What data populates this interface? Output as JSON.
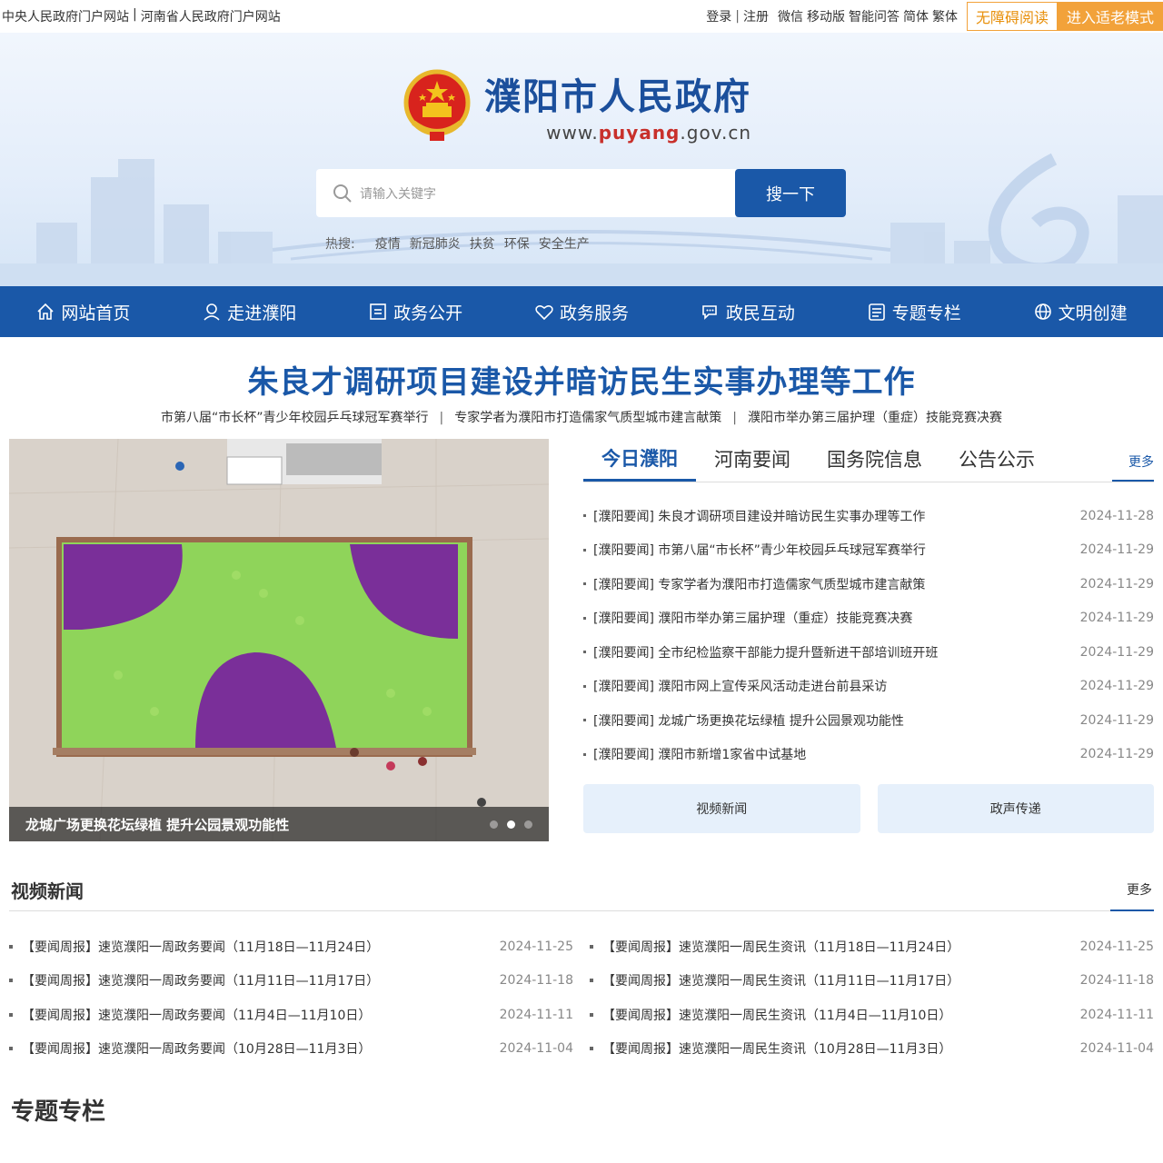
{
  "topbar": {
    "left_links": [
      "中央人民政府门户网站",
      "河南省人民政府门户网站"
    ],
    "login": "登录",
    "register": "注册",
    "right_links": [
      "微信",
      "移动版",
      "智能问答",
      "简体",
      "繁体"
    ],
    "accessible": "无障碍阅读",
    "elder": "进入适老模式"
  },
  "logo": {
    "title": "濮阳市人民政府",
    "url_pre": "www.",
    "url_hl": "puyang",
    "url_post": ".gov.cn"
  },
  "search": {
    "placeholder": "请输入关键字",
    "button": "搜一下",
    "hot_label": "热搜:",
    "hot_keywords": [
      "疫情",
      "新冠肺炎",
      "扶贫",
      "环保",
      "安全生产"
    ]
  },
  "nav": [
    {
      "label": "网站首页",
      "icon": "home-icon"
    },
    {
      "label": "走进濮阳",
      "icon": "person-icon"
    },
    {
      "label": "政务公开",
      "icon": "document-icon"
    },
    {
      "label": "政务服务",
      "icon": "heart-icon"
    },
    {
      "label": "政民互动",
      "icon": "chat-icon"
    },
    {
      "label": "专题专栏",
      "icon": "list-icon"
    },
    {
      "label": "文明创建",
      "icon": "globe-icon"
    }
  ],
  "headline": "朱良才调研项目建设并暗访民生实事办理等工作",
  "subheads": [
    "市第八届“市长杯”青少年校园乒乓球冠军赛举行",
    "专家学者为濮阳市打造儒家气质型城市建言献策",
    "濮阳市举办第三届护理（重症）技能竞赛决赛"
  ],
  "photo": {
    "caption": "龙城广场更换花坛绿植 提升公园景观功能性",
    "slides": 3,
    "active_slide": 2
  },
  "tabs": [
    "今日濮阳",
    "河南要闻",
    "国务院信息",
    "公告公示"
  ],
  "tabs_more": "更多",
  "news": [
    {
      "title": "[濮阳要闻] 朱良才调研项目建设并暗访民生实事办理等工作",
      "date": "2024-11-28"
    },
    {
      "title": "[濮阳要闻] 市第八届“市长杯”青少年校园乒乓球冠军赛举行",
      "date": "2024-11-29"
    },
    {
      "title": "[濮阳要闻] 专家学者为濮阳市打造儒家气质型城市建言献策",
      "date": "2024-11-29"
    },
    {
      "title": "[濮阳要闻] 濮阳市举办第三届护理（重症）技能竞赛决赛",
      "date": "2024-11-29"
    },
    {
      "title": "[濮阳要闻] 全市纪检监察干部能力提升暨新进干部培训班开班",
      "date": "2024-11-29"
    },
    {
      "title": "[濮阳要闻] 濮阳市网上宣传采风活动走进台前县采访",
      "date": "2024-11-29"
    },
    {
      "title": "[濮阳要闻] 龙城广场更换花坛绿植 提升公园景观功能性",
      "date": "2024-11-29"
    },
    {
      "title": "[濮阳要闻] 濮阳市新增1家省中试基地",
      "date": "2024-11-29"
    }
  ],
  "sub_buttons": [
    "视频新闻",
    "政声传递"
  ],
  "video": {
    "title": "视频新闻",
    "more": "更多",
    "left": [
      {
        "title": "【要闻周报】速览濮阳一周政务要闻（11月18日—11月24日）",
        "date": "2024-11-25"
      },
      {
        "title": "【要闻周报】速览濮阳一周政务要闻（11月11日—11月17日）",
        "date": "2024-11-18"
      },
      {
        "title": "【要闻周报】速览濮阳一周政务要闻（11月4日—11月10日）",
        "date": "2024-11-11"
      },
      {
        "title": "【要闻周报】速览濮阳一周政务要闻（10月28日—11月3日）",
        "date": "2024-11-04"
      }
    ],
    "right": [
      {
        "title": "【要闻周报】速览濮阳一周民生资讯（11月18日—11月24日）",
        "date": "2024-11-25"
      },
      {
        "title": "【要闻周报】速览濮阳一周民生资讯（11月11日—11月17日）",
        "date": "2024-11-18"
      },
      {
        "title": "【要闻周报】速览濮阳一周民生资讯（11月4日—11月10日）",
        "date": "2024-11-11"
      },
      {
        "title": "【要闻周报】速览濮阳一周民生资讯（10月28日—11月3日）",
        "date": "2024-11-04"
      }
    ]
  },
  "topics_title": "专题专栏",
  "colors": {
    "primary": "#1a58a8",
    "accent": "#f2a23a"
  }
}
